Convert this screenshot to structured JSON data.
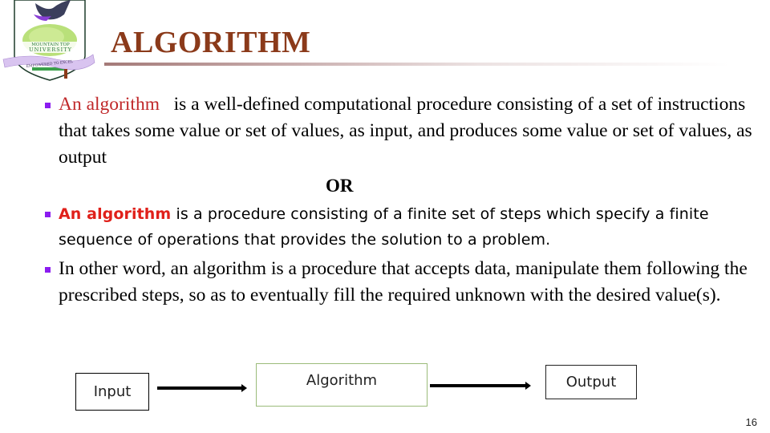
{
  "slide": {
    "title": "ALGORITHM",
    "logo": {
      "icon": "university-crest-icon",
      "name_line1": "MOUNTAIN TOP",
      "name_line2": "UNIVERSITY",
      "motto": "EMPOWERED TO EXCEL"
    },
    "bullets": [
      {
        "term": "An algorithm",
        "text": "   is a well-defined computational procedure consisting of a set of instructions that takes some value or set of values, as input, and produces some value or set of values, as output"
      },
      {
        "separator": "OR"
      },
      {
        "term": "An algorithm",
        "text": " is a procedure consisting of a finite set of steps which specify a finite sequence of operations that provides the solution to a problem."
      },
      {
        "text": "In other word, an algorithm is a procedure that accepts data, manipulate them following the prescribed steps, so as to eventually fill the required unknown with the desired value(s)."
      }
    ],
    "flow": {
      "input_label": "Input",
      "process_label": "Algorithm",
      "output_label": "Output"
    },
    "page_number": "16",
    "colors": {
      "title": "#8b3a1a",
      "bullet_marker": "#8b1cf0",
      "term_highlight_serif": "#c0282a",
      "term_highlight_sans": "#e0201a",
      "process_box_border": "#9bbb7a"
    }
  }
}
